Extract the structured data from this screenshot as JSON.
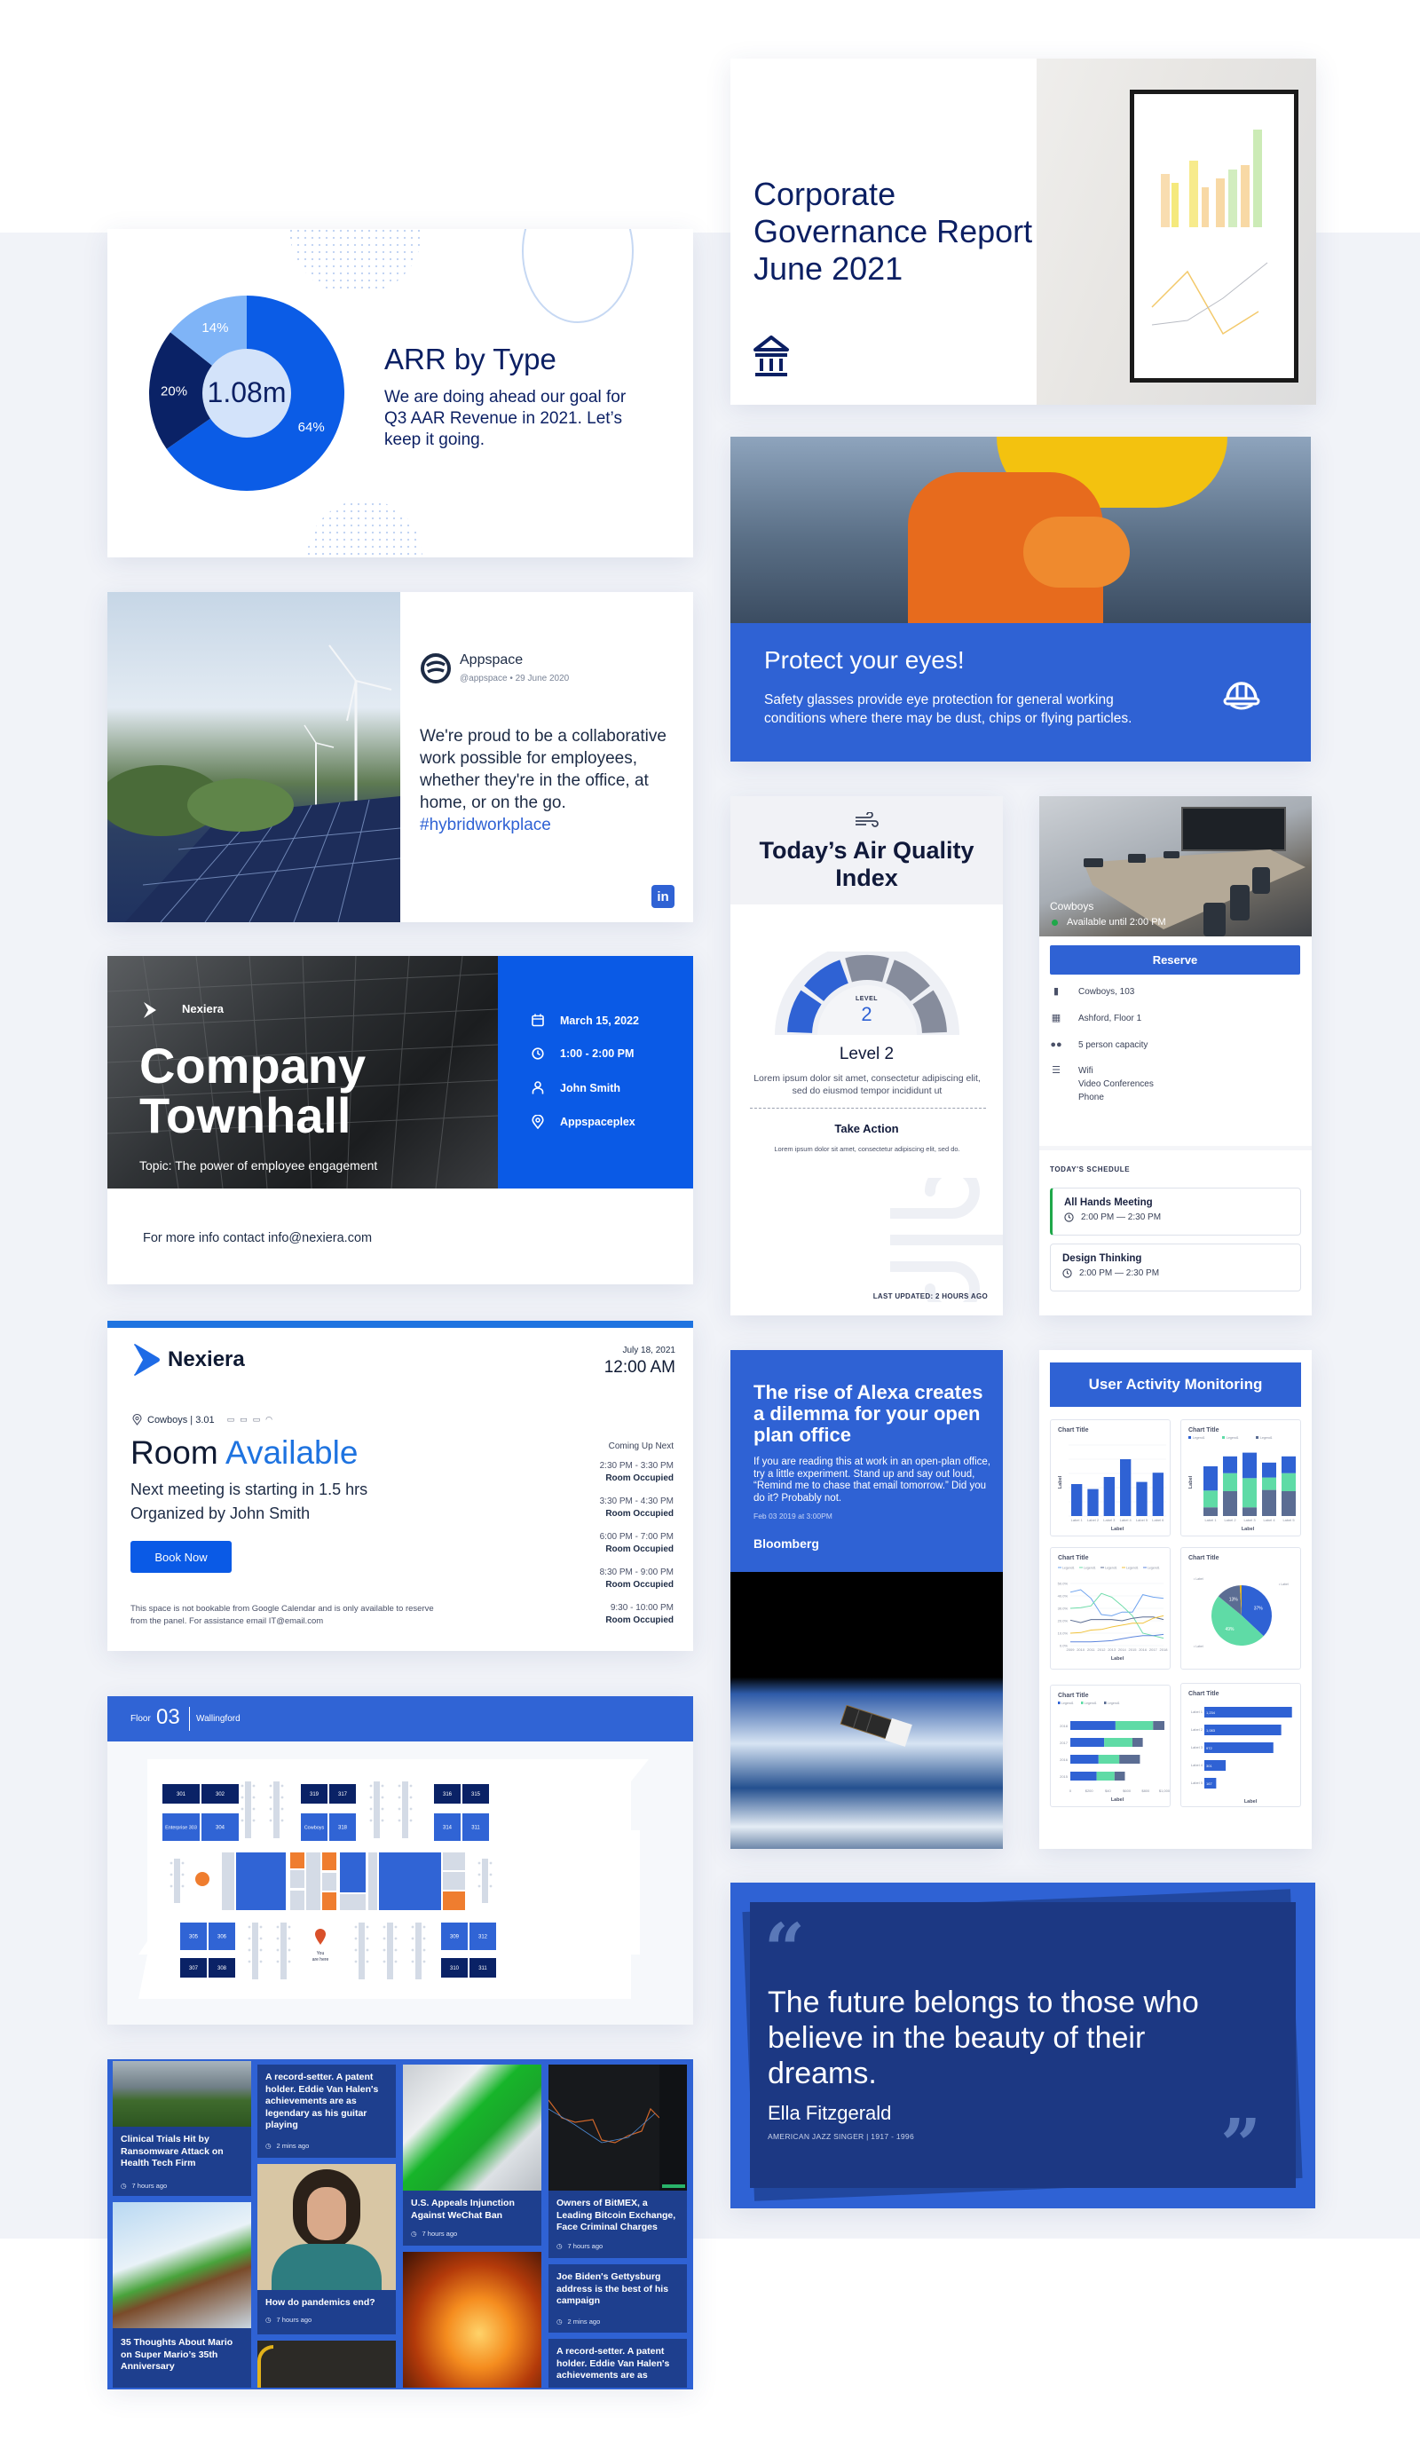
{
  "colors": {
    "primary_blue": "#2f62d4",
    "bright_blue": "#0a5ae6",
    "navy": "#0b1f63",
    "green": "#5fdba6",
    "slate": "#5b6d93",
    "gold": "#e3b21a",
    "orange": "#ef7d2f"
  },
  "arr_card": {
    "title": "ARR by Type",
    "description": "We are doing ahead our goal for Q3 AAR Revenue in 2021. Let’s keep it going.",
    "center_value": "1.08m",
    "chart_data": {
      "type": "pie",
      "values": [
        64,
        20,
        14
      ],
      "labels": [
        "64%",
        "20%",
        "14%"
      ],
      "colors": [
        "#0b5ce6",
        "#0a2266",
        "#7fb4f7"
      ],
      "center": "1.08m"
    }
  },
  "governance_card": {
    "title": "Corporate Governance Report June 2021",
    "icon": "bank-icon"
  },
  "safety_card": {
    "title": "Protect your eyes!",
    "description": "Safety glasses provide eye protection for general working conditions where there may be dust, chips or flying particles.",
    "icon": "hard-hat-icon"
  },
  "social_post": {
    "account_name": "Appspace",
    "handle": "@appspace",
    "date": "29 June 2020",
    "separator": "•",
    "body": "We're proud to be a collaborative work possible for employees, whether they're in the office, at home, or on the go.",
    "hashtag": "#hybridworkplace",
    "network_icon": "linkedin-icon",
    "network_label": "in"
  },
  "townhall": {
    "brand": "Nexiera",
    "title_line1": "Company",
    "title_line2": "Townhall",
    "topic": "Topic: The power of employee engagement",
    "date": "March 15, 2022",
    "time": "1:00 - 2:00 PM",
    "host": "John Smith",
    "location": "Appspaceplex",
    "footer": "For more info contact info@nexiera.com"
  },
  "air_quality": {
    "title": "Today’s Air Quality Index",
    "gauge_label": "LEVEL",
    "level_value": "2",
    "level": 2,
    "levels_total": 5,
    "level_title": "Level 2",
    "description": "Lorem ipsum dolor sit amet, consectetur adipiscing elit, sed do eiusmod tempor incididunt ut",
    "action_title": "Take Action",
    "action_text": "Lorem ipsum dolor sit amet, consectetur adipiscing elit, sed do.",
    "updated": "LAST UPDATED: 2 HOURS AGO"
  },
  "room_panel": {
    "room_name": "Cowboys",
    "availability": "Available until 2:00 PM",
    "reserve_label": "Reserve",
    "details": [
      {
        "icon": "door-icon",
        "glyph": "▮",
        "text": "Cowboys, 103"
      },
      {
        "icon": "building-icon",
        "glyph": "▦",
        "text": "Ashford, Floor 1"
      },
      {
        "icon": "people-icon",
        "glyph": "👥",
        "text": "5 person capacity"
      },
      {
        "icon": "amenities-icon",
        "glyph": "☰",
        "lines": [
          "Wifi",
          "Video Conferences",
          "Phone"
        ]
      }
    ],
    "schedule_heading": "TODAY'S SCHEDULE",
    "schedule": [
      {
        "title": "All Hands Meeting",
        "time": "2:00 PM — 2:30 PM"
      },
      {
        "title": "Design Thinking",
        "time": "2:00 PM — 2:30 PM"
      }
    ]
  },
  "room_display": {
    "brand": "Nexiera",
    "date": "July 18, 2021",
    "time": "12:00 AM",
    "location": "Cowboys | 3.01",
    "status_word1": "Room",
    "status_word2": "Available",
    "next_meeting": "Next meeting is starting in 1.5 hrs",
    "organizer": "Organized by John Smith",
    "book_label": "Book Now",
    "note": "This space is not bookable from Google Calendar and is only available to reserve from the panel. For assistance email IT@email.com",
    "upcoming_heading": "Coming Up Next",
    "upcoming": [
      {
        "time": "2:30 PM - 3:30 PM",
        "status": "Room Occupied"
      },
      {
        "time": "3:30 PM - 4:30 PM",
        "status": "Room Occupied"
      },
      {
        "time": "6:00 PM - 7:00 PM",
        "status": "Room Occupied"
      },
      {
        "time": "8:30 PM - 9:00 PM",
        "status": "Room Occupied"
      },
      {
        "time": "9:30 - 10:00 PM",
        "status": "Room Occupied"
      }
    ]
  },
  "article": {
    "title": "The rise of Alexa creates a dilemma for your open plan office",
    "description": "If you are reading this at work in an open-plan office, try a little experiment. Stand up and say out loud, “Remind me to chase that email tomorrow.” Did you do it? Probably not.",
    "date": "Feb 03 2019 at 3:00PM",
    "source": "Bloomberg"
  },
  "user_activity": {
    "title": "User Activity Monitoring",
    "chart_data": [
      {
        "type": "bar",
        "title": "Chart Title",
        "xlabel": "Label",
        "ylabel": "Label",
        "categories": [
          "Label 1",
          "Label 2",
          "Label 3",
          "Label 4",
          "Label 5",
          "Label 6"
        ],
        "values": [
          45,
          38,
          55,
          80,
          48,
          61
        ],
        "ylim": [
          0,
          100
        ]
      },
      {
        "type": "bar",
        "stacked": true,
        "title": "Chart Title",
        "xlabel": "Label",
        "ylabel": "Label",
        "legend": [
          "Legend1",
          "Legend1",
          "Legend1"
        ],
        "categories": [
          "Label 1",
          "Label 2",
          "Label 3",
          "Label 4",
          "Label 5"
        ],
        "series": [
          {
            "name": "Legend1",
            "values": [
              14,
              40,
              14,
              42,
              40
            ]
          },
          {
            "name": "Legend1",
            "values": [
              27,
              29,
              47,
              20,
              29
            ]
          },
          {
            "name": "Legend1",
            "values": [
              39,
              27,
              41,
              24,
              27
            ]
          }
        ],
        "ylim": [
          0,
          100
        ]
      },
      {
        "type": "line",
        "title": "Chart Title",
        "xlabel": "Label",
        "legend": [
          "Legend1",
          "Legend1",
          "Legend1",
          "Legend1",
          "Legend1"
        ],
        "x": [
          "2009",
          "2010",
          "2011",
          "2012",
          "2013",
          "2014",
          "2015",
          "2016",
          "2017",
          "2018"
        ],
        "series": [
          {
            "name": "Legend1",
            "values": [
              43,
              45,
              38,
              25,
              24,
              27,
              27,
              41,
              39,
              38
            ]
          },
          {
            "name": "Legend1",
            "values": [
              30,
              30.5,
              32,
              42,
              39,
              32,
              24,
              10,
              8,
              6
            ]
          },
          {
            "name": "Legend1",
            "values": [
              20.5,
              18.5,
              21,
              21,
              21,
              20,
              22,
              23,
              23,
              21
            ]
          },
          {
            "name": "Legend1",
            "values": [
              10,
              10.5,
              12.5,
              13,
              15,
              16.5,
              18,
              18,
              22,
              24
            ]
          },
          {
            "name": "Legend1",
            "values": [
              3,
              3,
              3,
              3.5,
              4,
              5.5,
              7,
              8,
              8,
              9
            ]
          }
        ],
        "ylim": [
          0,
          50
        ],
        "yticks": [
          "0.0%",
          "10.0%",
          "20.0%",
          "30.0%",
          "40.0%",
          "50.0%"
        ]
      },
      {
        "type": "pie",
        "title": "Chart Title",
        "values": [
          37,
          49,
          13,
          1
        ],
        "labels": [
          "37%",
          "49%",
          "13%",
          ""
        ],
        "colors": [
          "#2f62d4",
          "#5fdba6",
          "#5b6d93",
          "#e3b21a"
        ]
      },
      {
        "type": "bar",
        "orientation": "horizontal",
        "stacked": true,
        "title": "Chart Title",
        "xlabel": "Label",
        "ylabel": "Label",
        "legend": [
          "Legend1",
          "Legend1",
          "Legend1"
        ],
        "categories": [
          "2018",
          "2017",
          "2016",
          "2015"
        ],
        "series": [
          {
            "name": "Legend1",
            "values": [
              480,
              360,
              300,
              280
            ]
          },
          {
            "name": "Legend1",
            "values": [
              400,
              300,
              220,
              190
            ]
          },
          {
            "name": "Legend1",
            "values": [
              120,
              110,
              220,
              110
            ]
          }
        ],
        "xticks": [
          "0",
          "$200",
          "$40",
          "$600",
          "$800",
          "$1,000"
        ],
        "xlim": [
          0,
          1000
        ]
      },
      {
        "type": "bar",
        "orientation": "horizontal",
        "title": "Chart Title",
        "xlabel": "Label",
        "ylabel": "Label",
        "categories": [
          "Label 1",
          "Label 2",
          "Label 3",
          "Label 4",
          "Label 5"
        ],
        "values": [
          1234,
          1083,
          972,
          301,
          167
        ],
        "labels": [
          "1,234",
          "1,083",
          "972",
          "301",
          "167"
        ],
        "xlim": [
          0,
          1250
        ]
      }
    ]
  },
  "floor_map": {
    "floor_label": "Floor",
    "floor_number": "03",
    "building": "Wallingford",
    "you_are_here": "You are here",
    "rooms_dark": [
      "301",
      "302",
      "319",
      "317",
      "316",
      "315",
      "307",
      "308",
      "310",
      "311"
    ],
    "rooms_light": [
      "Enterprise 303",
      "304",
      "Cowboys",
      "318",
      "314",
      "311",
      "305",
      "306",
      "309",
      "312"
    ]
  },
  "news": [
    {
      "title": "Clinical Trials Hit by Ransomware Attack on Health Tech Firm",
      "time": "7 hours ago"
    },
    {
      "title": "35 Thoughts About Mario on Super Mario’s 35th Anniversary",
      "time": ""
    },
    {
      "title": "A record-setter. A patent holder. Eddie Van Halen's achievements are as legendary as his guitar playing",
      "time": "2 mins ago"
    },
    {
      "title": "How do pandemics end?",
      "time": "7 hours ago"
    },
    {
      "title": "U.S. Appeals Injunction Against WeChat Ban",
      "time": "7 hours ago"
    },
    {
      "title": "Owners of BitMEX, a Leading Bitcoin Exchange, Face Criminal Charges",
      "time": "7 hours ago"
    },
    {
      "title": "Joe Biden's Gettysburg address is the best of his campaign",
      "time": "2 mins ago"
    },
    {
      "title": "A record-setter. A patent holder. Eddie Van Halen's achievements are as",
      "time": ""
    }
  ],
  "quote": {
    "text": "The future belongs to those who believe in the beauty of their dreams.",
    "author": "Ella Fitzgerald",
    "role": "AMERICAN JAZZ SINGER | 1917 - 1996",
    "open_mark": "“",
    "close_mark": "”"
  }
}
